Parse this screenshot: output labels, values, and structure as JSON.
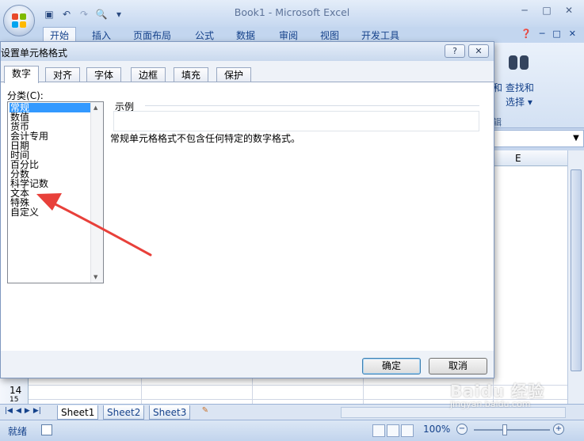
{
  "app": {
    "title": "Book1 - Microsoft Excel",
    "ribbon_tabs": [
      "开始",
      "插入",
      "页面布局",
      "公式",
      "数据",
      "审阅",
      "视图",
      "开发工具"
    ],
    "find_group": {
      "label_left": "和",
      "find_label": "查找和",
      "select_left": "•",
      "select_label": "选择",
      "caption": "辑"
    },
    "column_header": "E",
    "rows": [
      "14",
      "15"
    ],
    "sheets": [
      "Sheet1",
      "Sheet2",
      "Sheet3"
    ],
    "status": "就绪",
    "zoom": "100%"
  },
  "dialog": {
    "title": "设置单元格格式",
    "help_label": "?",
    "close_label": "✕",
    "tabs": [
      "数字",
      "对齐",
      "字体",
      "边框",
      "填充",
      "保护"
    ],
    "category_label": "分类",
    "category_accel": "(C)",
    "category_colon": ":",
    "categories": [
      "常规",
      "数值",
      "货币",
      "会计专用",
      "日期",
      "时间",
      "百分比",
      "分数",
      "科学记数",
      "文本",
      "特殊",
      "自定义"
    ],
    "selected_category": "常规",
    "sample_label": "示例",
    "description": "常规单元格格式不包含任何特定的数字格式。",
    "ok_label": "确定",
    "cancel_label": "取消"
  },
  "watermark": {
    "logo": "Baidu 经验",
    "url": "jingyan.baidu.com"
  },
  "colors": {
    "accent": "#3399ff",
    "arrow": "#e8403a",
    "ribbon": "#c3d6ef"
  }
}
